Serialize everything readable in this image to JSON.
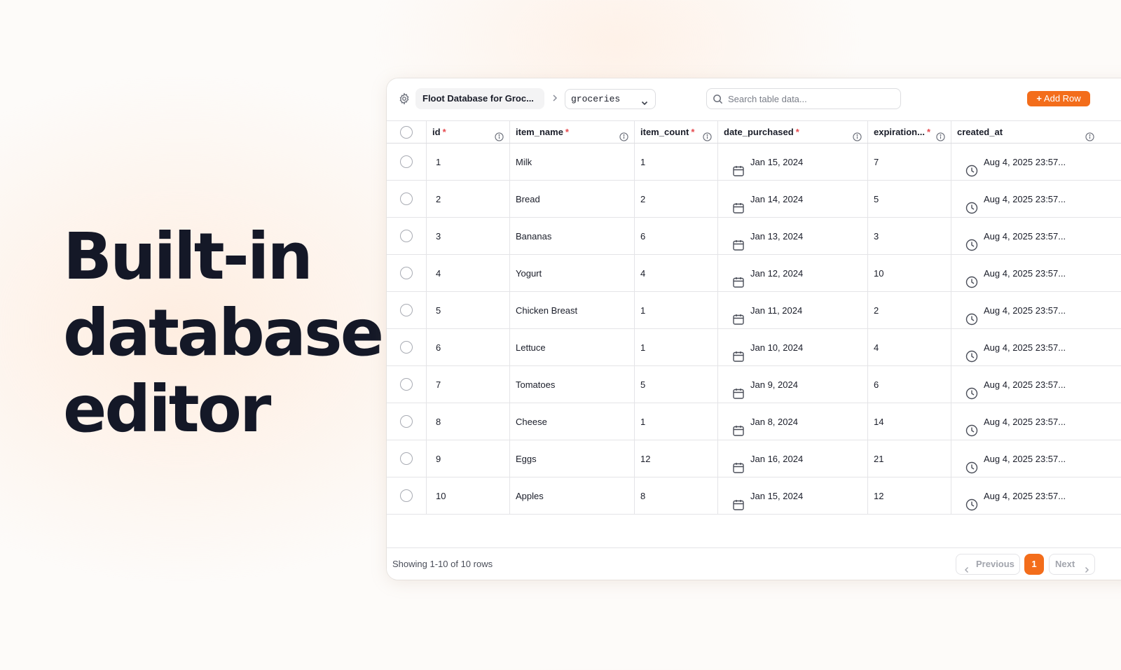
{
  "headline": {
    "lines": [
      "Built-in",
      "database",
      "editor"
    ]
  },
  "toolbar": {
    "settings_icon": "gear-icon",
    "database_name": "Floot Database for Groc...",
    "breadcrumb_icon": "chevron-right-icon",
    "table_selected": "groceries",
    "search_placeholder": "Search table data...",
    "add_row_label": "Add Row",
    "accent_color": "#f36d1b"
  },
  "table": {
    "columns": [
      {
        "label": "id",
        "required": "*"
      },
      {
        "label": "item_name",
        "required": "*"
      },
      {
        "label": "item_count",
        "required": "*"
      },
      {
        "label": "date_purchased",
        "required": "*"
      },
      {
        "label": "expiration...",
        "required": "*"
      },
      {
        "label": "created_at",
        "required": ""
      }
    ],
    "rows": [
      {
        "id": "1",
        "item_name": "Milk",
        "item_count": "1",
        "date_purchased": "Jan 15, 2024",
        "expiration": "7",
        "created_at": "Aug 4, 2025 23:57..."
      },
      {
        "id": "2",
        "item_name": "Bread",
        "item_count": "2",
        "date_purchased": "Jan 14, 2024",
        "expiration": "5",
        "created_at": "Aug 4, 2025 23:57..."
      },
      {
        "id": "3",
        "item_name": "Bananas",
        "item_count": "6",
        "date_purchased": "Jan 13, 2024",
        "expiration": "3",
        "created_at": "Aug 4, 2025 23:57..."
      },
      {
        "id": "4",
        "item_name": "Yogurt",
        "item_count": "4",
        "date_purchased": "Jan 12, 2024",
        "expiration": "10",
        "created_at": "Aug 4, 2025 23:57..."
      },
      {
        "id": "5",
        "item_name": "Chicken Breast",
        "item_count": "1",
        "date_purchased": "Jan 11, 2024",
        "expiration": "2",
        "created_at": "Aug 4, 2025 23:57..."
      },
      {
        "id": "6",
        "item_name": "Lettuce",
        "item_count": "1",
        "date_purchased": "Jan 10, 2024",
        "expiration": "4",
        "created_at": "Aug 4, 2025 23:57..."
      },
      {
        "id": "7",
        "item_name": "Tomatoes",
        "item_count": "5",
        "date_purchased": "Jan 9, 2024",
        "expiration": "6",
        "created_at": "Aug 4, 2025 23:57..."
      },
      {
        "id": "8",
        "item_name": "Cheese",
        "item_count": "1",
        "date_purchased": "Jan 8, 2024",
        "expiration": "14",
        "created_at": "Aug 4, 2025 23:57..."
      },
      {
        "id": "9",
        "item_name": "Eggs",
        "item_count": "12",
        "date_purchased": "Jan 16, 2024",
        "expiration": "21",
        "created_at": "Aug 4, 2025 23:57..."
      },
      {
        "id": "10",
        "item_name": "Apples",
        "item_count": "8",
        "date_purchased": "Jan 15, 2024",
        "expiration": "12",
        "created_at": "Aug 4, 2025 23:57..."
      }
    ]
  },
  "footer": {
    "showing_text": "Showing 1-10 of 10 rows",
    "previous_label": "Previous",
    "current_page": "1",
    "next_label": "Next"
  }
}
